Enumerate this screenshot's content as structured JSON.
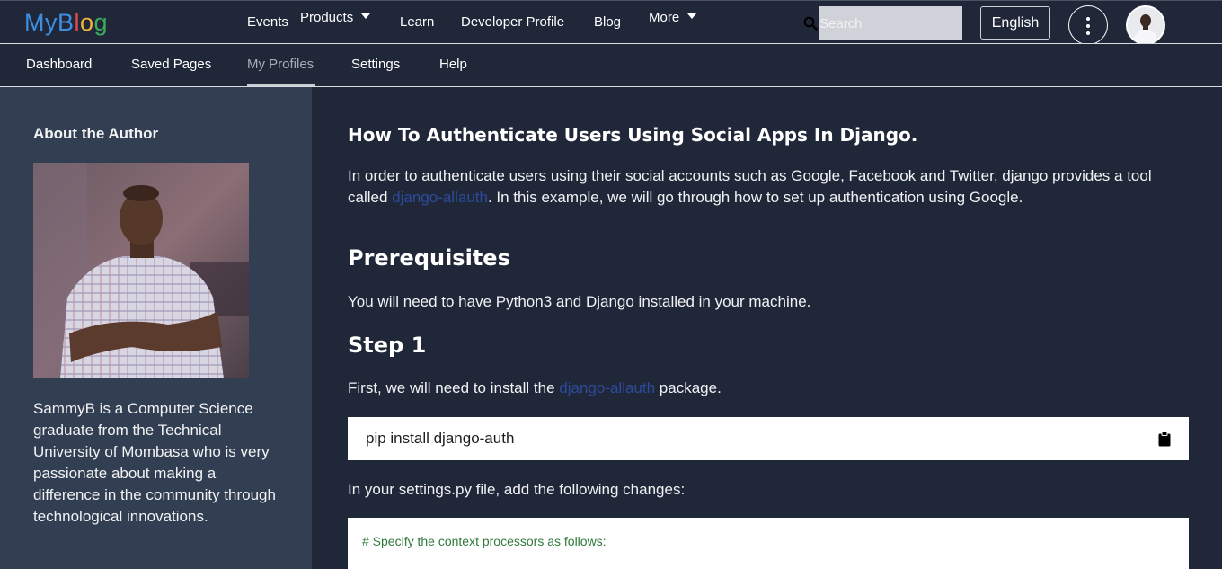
{
  "brand": {
    "logo_letters": [
      {
        "char": "M",
        "color": "#3d8ee0"
      },
      {
        "char": "y",
        "color": "#3d8ee0"
      },
      {
        "char": "B",
        "color": "#3d8ee0"
      },
      {
        "char": "l",
        "color": "#e24b4b"
      },
      {
        "char": "o",
        "color": "#f2b53a"
      },
      {
        "char": "g",
        "color": "#3daa5c"
      }
    ]
  },
  "topnav": {
    "events": "Events",
    "products": "Products",
    "learn": "Learn",
    "developer_profile": "Developer Profile",
    "blog": "Blog",
    "more": "More",
    "search_placeholder": "Search",
    "language": "English"
  },
  "subnav": {
    "items": [
      "Dashboard",
      "Saved Pages",
      "My Profiles",
      "Settings",
      "Help"
    ],
    "active": "My Profiles"
  },
  "sidebar": {
    "title": "About the Author",
    "bio": "SammyB is a Computer Science graduate from the Technical University of Mombasa who is very passionate about making a difference in the community through technological innovations."
  },
  "article": {
    "title": "How To Authenticate Users Using Social Apps In Django.",
    "intro_before": "In order to authenticate users using their social accounts such as Google, Facebook and Twitter, django provides a tool called ",
    "intro_link": "django-allauth",
    "intro_after": ". In this example, we will go through how to set up authentication using Google.",
    "prereq_heading": "Prerequisites",
    "prereq_text": "You will need to have Python3 and Django installed in your machine.",
    "step1_heading": "Step 1",
    "step1_before": "First, we will need to install the ",
    "step1_link": "django-allauth",
    "step1_after": " package.",
    "install_command": "pip install django-auth",
    "settings_text": "In your settings.py file, add the following changes:",
    "code_comment": "# Specify the context processors as follows:"
  },
  "colors": {
    "background": "#1f2739",
    "sidebar": "#323e51",
    "link": "#2e4a9a",
    "code_comment": "#2f7a3b"
  },
  "icons": [
    "search-icon",
    "kebab-menu-icon",
    "chevron-down-icon",
    "clipboard-icon"
  ]
}
